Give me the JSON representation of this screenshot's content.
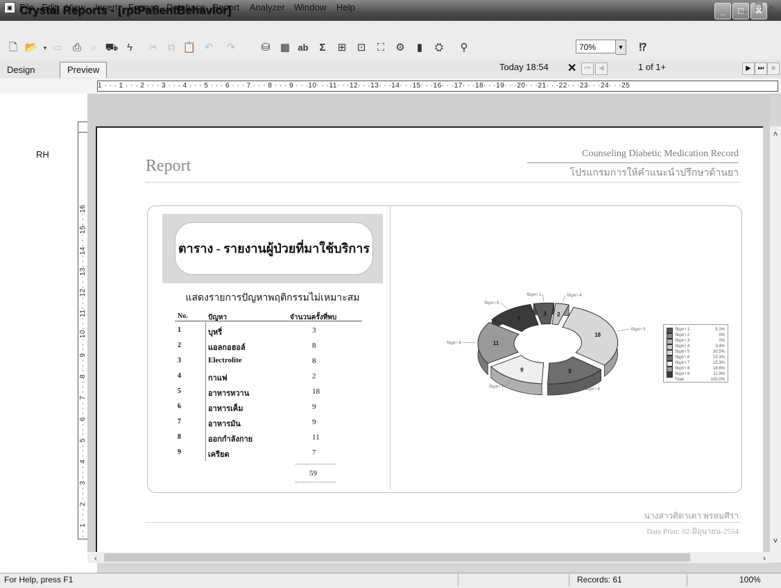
{
  "window": {
    "title": "Crystal Reports - [rptPatientBehavior]",
    "title_icon": "crystal-reports-icon",
    "controls": {
      "minimize": "_",
      "maximize": "□",
      "close": "✕"
    }
  },
  "menu": {
    "items": [
      "File",
      "Edit",
      "View",
      "Insert",
      "Format",
      "Database",
      "Report",
      "Analyzer",
      "Window",
      "Help"
    ],
    "mdi_controls": {
      "minimize": "_",
      "restore": "❐",
      "close": "×"
    }
  },
  "toolbar": {
    "zoom_value": "70%"
  },
  "tabs": {
    "design": "Design",
    "preview": "Preview"
  },
  "navigation": {
    "today": "Today 18:54",
    "page_indicator": "1 of 1+"
  },
  "rulers": {
    "horizontal": "1 · · · 1 · · · 2 · · · 3 · · · 4 · · · 5 · · · 6 · · · 7 · · · 8 · · · 9 · · ·10· · ·11· · ·12· · ·13· · ·14· · ·15· · ·16· · ·17· · ·18· · ·19· · ·20· · ·21· · ·22· · ·23· · ·24· · ·25",
    "vertical": "· · 1 · · · 2 · · · 3 · · · 4 · · · 5 · · · 6 · · · 7 · · · 8 · · · 9 · · ·10· · ·11· · ·12· · ·13· · ·14· · ·15· · ·16"
  },
  "section_label": "RH",
  "report": {
    "title": "Report",
    "header_en": "Counseling Diabetic Medication Record",
    "header_th": "โปรแกรมการให้คำแนะนำปรึกษาด้านยา",
    "table_title": "ตาราง - รายงานผู้ป่วยที่มาใช้บริการ",
    "table_subtitle": "แสดงรายการปัญหาพฤติกรรมไม่เหมาะสม",
    "columns": {
      "no": "No.",
      "problem": "ปัญหา",
      "count": "จำนวนครั้งที่พบ"
    },
    "rows": [
      {
        "no": "1",
        "problem": "บุหรี่",
        "count": "3"
      },
      {
        "no": "2",
        "problem": "แอลกอฮอล์",
        "count": "8"
      },
      {
        "no": "3",
        "problem": "Electrolite",
        "count": "8"
      },
      {
        "no": "4",
        "problem": "กาแฟ",
        "count": "2"
      },
      {
        "no": "5",
        "problem": "อาหารหวาน",
        "count": "18"
      },
      {
        "no": "6",
        "problem": "อาหารเค็ม",
        "count": "9"
      },
      {
        "no": "7",
        "problem": "อาหารมัน",
        "count": "9"
      },
      {
        "no": "8",
        "problem": "ออกกำลังกาย",
        "count": "11"
      },
      {
        "no": "9",
        "problem": "เครียด",
        "count": "7"
      }
    ],
    "total": "59",
    "footer_name": "นางสาวศิดาเดา พรหมศีรา",
    "footer_date": "Date Print: 02-มิถุนายน-2554"
  },
  "chart_data": {
    "type": "pie",
    "categories": [
      "ปัญหา 1",
      "ปัญหา 2",
      "ปัญหา 3",
      "ปัญหา 4",
      "ปัญหา 5",
      "ปัญหา 6",
      "ปัญหา 7",
      "ปัญหา 8",
      "ปัญหา 9"
    ],
    "slice_labels": [
      "3",
      "",
      "",
      "2",
      "18",
      "9",
      "9",
      "11",
      "7"
    ],
    "values": [
      3,
      0,
      0,
      2,
      18,
      9,
      9,
      11,
      7
    ],
    "colors": [
      "#5a5a5a",
      "#8a8a8a",
      "#b0b0b0",
      "#c8c8c8",
      "#d8d8d8",
      "#6e6e6e",
      "#efefef",
      "#9a9a9a",
      "#3a3a3a"
    ],
    "legend": {
      "items": [
        {
          "name": "ปัญหา 1",
          "pct": "5.1%"
        },
        {
          "name": "ปัญหา 2",
          "pct": "0%"
        },
        {
          "name": "ปัญหา 3",
          "pct": "0%"
        },
        {
          "name": "ปัญหา 4",
          "pct": "3.4%"
        },
        {
          "name": "ปัญหา 5",
          "pct": "30.5%"
        },
        {
          "name": "ปัญหา 6",
          "pct": "15.3%"
        },
        {
          "name": "ปัญหา 7",
          "pct": "15.3%"
        },
        {
          "name": "ปัญหา 8",
          "pct": "18.6%"
        },
        {
          "name": "ปัญหา 9",
          "pct": "11.9%"
        }
      ],
      "total_label": "Total",
      "total_pct": "100.0%",
      "placement": "right"
    }
  },
  "status": {
    "help": "For Help, press F1",
    "records": "Records: 61",
    "zoom": "100%"
  }
}
